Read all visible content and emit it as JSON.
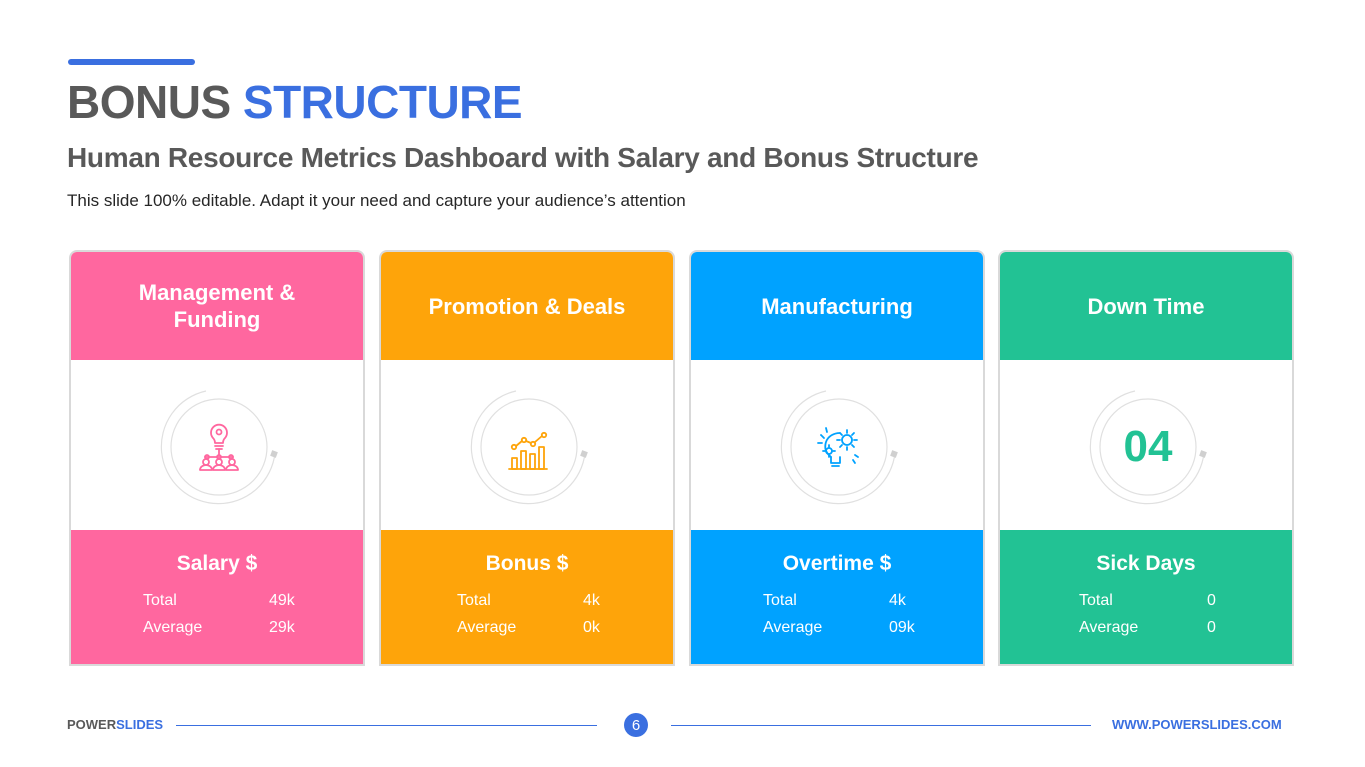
{
  "header": {
    "title_part1": "BONUS",
    "title_part2": "STRUCTURE",
    "subtitle": "Human Resource Metrics Dashboard with Salary and Bonus Structure",
    "description": "This slide 100% editable. Adapt it your need and capture your audience’s attention"
  },
  "colors": {
    "accent": "#3a6fe0",
    "pink": "#ff679f",
    "orange": "#fea40a",
    "blue": "#00a2ff",
    "green": "#22c294"
  },
  "cards": [
    {
      "header": "Management & Funding",
      "icon": "idea-team-icon",
      "footer_title": "Salary $",
      "stats": [
        {
          "label": "Total",
          "value": "49k"
        },
        {
          "label": "Average",
          "value": "29k"
        }
      ]
    },
    {
      "header": "Promotion & Deals",
      "icon": "growth-chart-icon",
      "footer_title": "Bonus $",
      "stats": [
        {
          "label": "Total",
          "value": "4k"
        },
        {
          "label": "Average",
          "value": "0k"
        }
      ]
    },
    {
      "header": "Manufacturing",
      "icon": "lightbulb-gears-icon",
      "footer_title": "Overtime $",
      "stats": [
        {
          "label": "Total",
          "value": "4k"
        },
        {
          "label": "Average",
          "value": "09k"
        }
      ]
    },
    {
      "header": "Down Time",
      "number": "04",
      "footer_title": "Sick Days",
      "stats": [
        {
          "label": "Total",
          "value": "0"
        },
        {
          "label": "Average",
          "value": "0"
        }
      ]
    }
  ],
  "footer": {
    "brand_part1": "POWER",
    "brand_part2": "SLIDES",
    "page_number": "6",
    "url": "WWW.POWERSLIDES.COM"
  }
}
